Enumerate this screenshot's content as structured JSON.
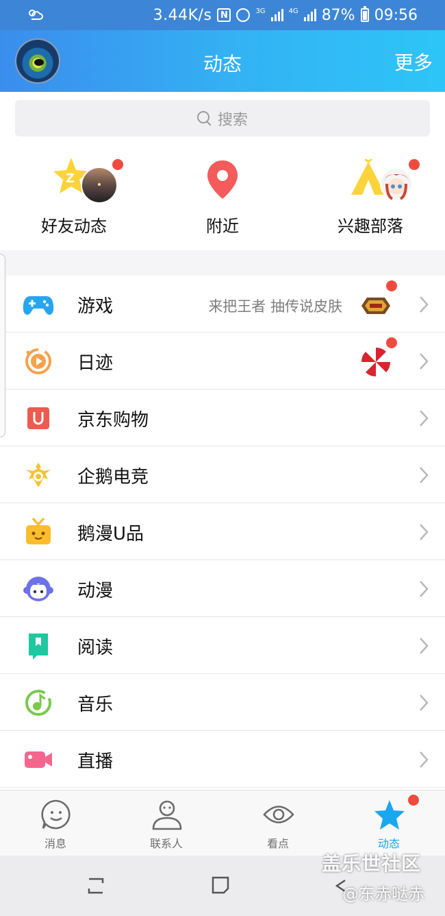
{
  "status_bar": {
    "speed": "3.44K/s",
    "net_3g": "3G",
    "net_4g": "4G",
    "battery": "87%",
    "time": "09:56",
    "icons": [
      "weather-icon",
      "nfc-icon",
      "alarm-icon",
      "signal-icon",
      "battery-icon"
    ]
  },
  "header": {
    "title": "动态",
    "more": "更多"
  },
  "search": {
    "placeholder": "搜索"
  },
  "quick": {
    "friends": "好友动态",
    "nearby": "附近",
    "tribe": "兴趣部落"
  },
  "list": {
    "game": {
      "label": "游戏",
      "extra": "来把王者 抽传说皮肤"
    },
    "diary": {
      "label": "日迹"
    },
    "jd": {
      "label": "京东购物"
    },
    "esports": {
      "label": "企鹅电竞"
    },
    "uproduct": {
      "label": "鹅漫U品"
    },
    "anime": {
      "label": "动漫"
    },
    "reading": {
      "label": "阅读"
    },
    "music": {
      "label": "音乐"
    },
    "live": {
      "label": "直播"
    }
  },
  "tabs": {
    "messages": "消息",
    "contacts": "联系人",
    "watch": "看点",
    "feed": "动态"
  },
  "watermark": {
    "title": "盖乐世社区",
    "sub": "@东赤哒赤"
  },
  "colors": {
    "header_start": "#3b8ded",
    "header_end": "#2dc5f7",
    "badge": "#f04a3e",
    "active_tab": "#19a7f0"
  }
}
